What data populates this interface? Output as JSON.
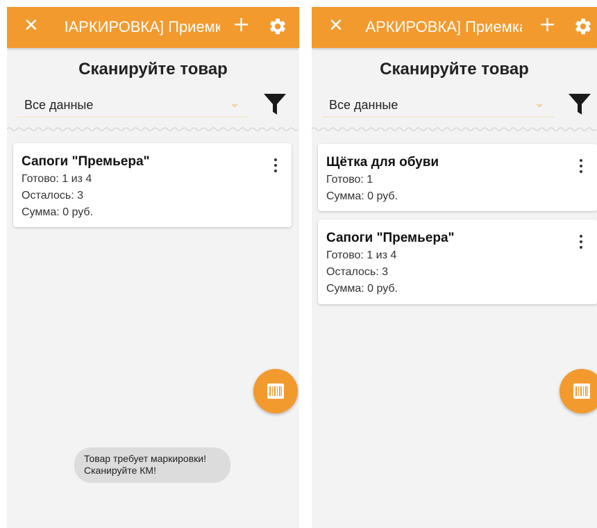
{
  "screens": [
    {
      "appbar": {
        "title": "[МАРКИРОВКА] Приемка",
        "add_label": "+"
      },
      "heading": "Сканируйте товар",
      "filter": {
        "value": "Все данные"
      },
      "cards": [
        {
          "name": "Сапоги \"Премьера\"",
          "lines": [
            "Готово: 1 из 4",
            "Осталось: 3",
            "Сумма: 0 руб."
          ]
        }
      ],
      "toast": {
        "line1": "Товар требует маркировки!",
        "line2": "Сканируйте КМ!"
      }
    },
    {
      "appbar": {
        "title": "[МАРКИРОВКА] Приемка",
        "add_label": "+"
      },
      "heading": "Сканируйте товар",
      "filter": {
        "value": "Все данные"
      },
      "cards": [
        {
          "name": "Щётка для обуви",
          "lines": [
            "Готово: 1",
            "Сумма: 0 руб."
          ]
        },
        {
          "name": "Сапоги \"Премьера\"",
          "lines": [
            "Готово: 1 из 4",
            "Осталось: 3",
            "Сумма: 0 руб."
          ]
        }
      ]
    }
  ],
  "icons": {
    "close": "close-icon",
    "add": "plus-icon",
    "settings": "gear-icon",
    "filter": "funnel-icon",
    "more": "more-vert-icon",
    "scan": "barcode-icon"
  },
  "colors": {
    "accent": "#f39a2e",
    "background": "#f3f3f3",
    "card": "#ffffff",
    "toast": "#dcdcdc"
  }
}
